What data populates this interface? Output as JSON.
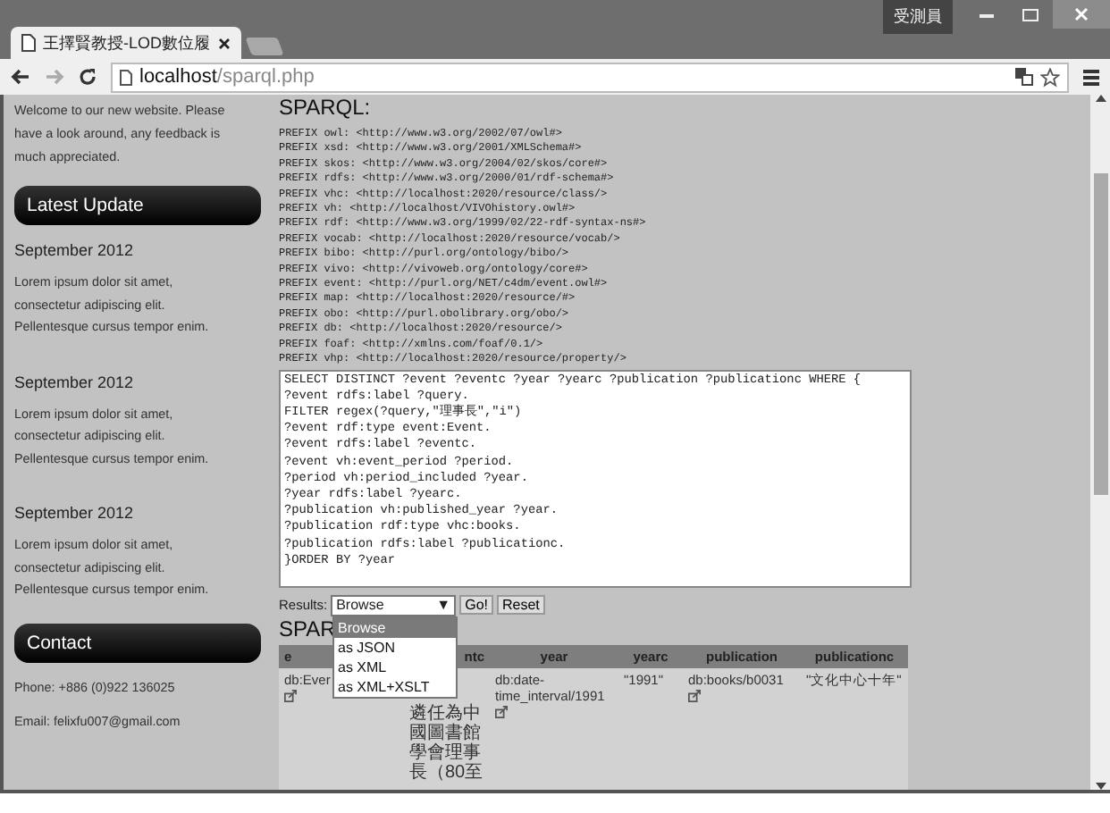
{
  "browser": {
    "tab_title": "王擇賢教授-LOD數位履",
    "user_badge": "受測員",
    "url_host": "localhost",
    "url_path": "/sparql.php"
  },
  "sidebar": {
    "intro": "Welcome to our new website. Please\nhave a look around, any feedback is\nmuch appreciated.",
    "latest_update": {
      "heading": "Latest Update",
      "entries": [
        {
          "date": "September 2012",
          "text": "Lorem ipsum dolor sit amet,\nconsectetur adipiscing elit.\nPellentesque cursus tempor enim."
        },
        {
          "date": "September 2012",
          "text": "Lorem ipsum dolor sit amet,\nconsectetur adipiscing elit.\nPellentesque cursus tempor enim."
        },
        {
          "date": "September 2012",
          "text": "Lorem ipsum dolor sit amet,\nconsectetur adipiscing elit.\nPellentesque cursus tempor enim."
        }
      ]
    },
    "contact": {
      "heading": "Contact",
      "lines": [
        "Phone: +886 (0)922 136025",
        "Email: felixfu007@gmail.com"
      ]
    }
  },
  "main": {
    "heading": "SPARQL:",
    "prefixes": [
      "PREFIX owl: <http://www.w3.org/2002/07/owl#>",
      "PREFIX xsd: <http://www.w3.org/2001/XMLSchema#>",
      "PREFIX skos: <http://www.w3.org/2004/02/skos/core#>",
      "PREFIX rdfs: <http://www.w3.org/2000/01/rdf-schema#>",
      "PREFIX vhc: <http://localhost:2020/resource/class/>",
      "PREFIX vh: <http://localhost/VIVOhistory.owl#>",
      "PREFIX rdf: <http://www.w3.org/1999/02/22-rdf-syntax-ns#>",
      "PREFIX vocab: <http://localhost:2020/resource/vocab/>",
      "PREFIX bibo: <http://purl.org/ontology/bibo/>",
      "PREFIX vivo: <http://vivoweb.org/ontology/core#>",
      "PREFIX event: <http://purl.org/NET/c4dm/event.owl#>",
      "PREFIX map: <http://localhost:2020/resource/#>",
      "PREFIX obo: <http://purl.obolibrary.org/obo/>",
      "PREFIX db: <http://localhost:2020/resource/>",
      "PREFIX foaf: <http://xmlns.com/foaf/0.1/>",
      "PREFIX vhp: <http://localhost:2020/resource/property/>"
    ],
    "query": "SELECT DISTINCT ?event ?eventc ?year ?yearc ?publication ?publicationc WHERE {\n?event rdfs:label ?query.\nFILTER regex(?query,\"理事長\",\"i\")\n?event rdf:type event:Event.\n?event rdfs:label ?eventc.\n?event vh:event_period ?period.\n?period vh:period_included ?year.\n?year rdfs:label ?yearc.\n?publication vh:published_year ?year.\n?publication rdf:type vhc:books.\n?publication rdfs:label ?publicationc.\n}ORDER BY ?year",
    "results": {
      "label": "Results:",
      "format": {
        "value": "Browse",
        "arrow": "▼",
        "expanded": true,
        "options": [
          {
            "label": "Browse",
            "selected": true
          },
          {
            "label": "as JSON",
            "selected": false
          },
          {
            "label": "as XML",
            "selected": false
          },
          {
            "label": "as XML+XSLT",
            "selected": false
          }
        ]
      },
      "buttons": [
        "Go!",
        "Reset"
      ]
    },
    "results_heading": "SPAR",
    "table": {
      "columns": [
        "e",
        "ntc",
        "year",
        "yearc",
        "publication",
        "publicationc"
      ],
      "rows": [
        [
          {
            "text": "db:Ever",
            "link": true
          },
          {
            "text": "遴任為中國圖書館學會理事長（80至",
            "link": false
          },
          {
            "text": "db:date-time_interval/1991",
            "link": true
          },
          {
            "text": "\"1991\"",
            "link": false
          },
          {
            "text": "db:books/b0031",
            "link": true
          },
          {
            "text": "\"文化中心十年\"",
            "link": false
          }
        ]
      ]
    }
  }
}
